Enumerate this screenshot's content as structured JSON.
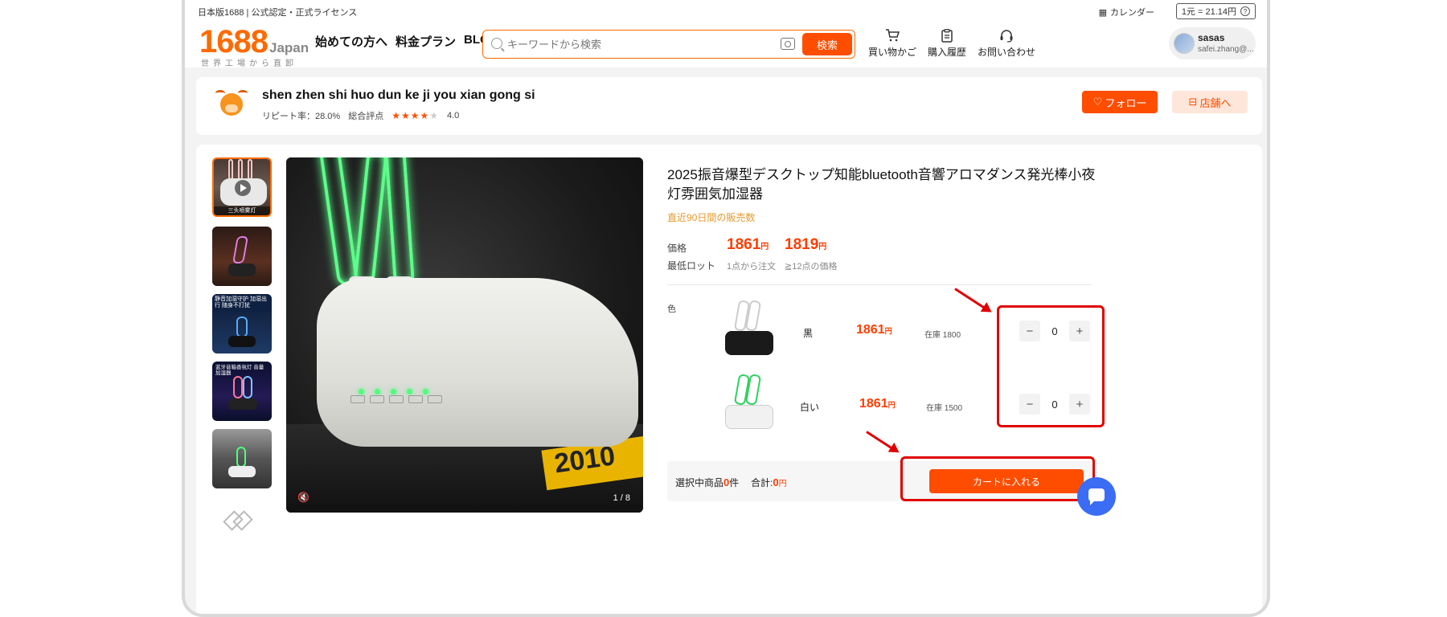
{
  "topbar": {
    "left_text": "日本版1688 | 公式認定・正式ライセンス",
    "calendar_label": "カレンダー",
    "rate_text": "1元 = 21.14円",
    "help_icon": "question-circle-icon",
    "calendar_icon": "calendar-icon"
  },
  "header": {
    "logo_number": "1688",
    "logo_suffix": "Japan",
    "logo_sub": "世界工場から直卸",
    "nav": [
      "始めての方へ",
      "料金プラン",
      "BLOG"
    ],
    "search": {
      "placeholder": "キーワードから検索",
      "button": "検索",
      "icon": "search-icon",
      "camera_icon": "camera-icon"
    },
    "icons": [
      {
        "label": "買い物かご",
        "icon": "cart-icon"
      },
      {
        "label": "購入履歴",
        "icon": "clipboard-icon"
      },
      {
        "label": "お問い合わせ",
        "icon": "headset-icon"
      }
    ],
    "user": {
      "name": "sasas",
      "email": "safei.zhang@..."
    }
  },
  "shop": {
    "name": "shen zhen shi huo dun ke ji you xian gong si",
    "repeat_label": "リピート率：28.0%",
    "rating_label": "総合評点",
    "rating_value": "4.0",
    "rating_stars": 4,
    "follow_label": "フォロー",
    "store_label": "店舗へ"
  },
  "product": {
    "title": "2025振音爆型デスクトップ知能bluetooth音響アロマダンス発光棒小夜灯雰囲気加湿器",
    "sold_label": "直近90日間の販売数",
    "price_label": "価格",
    "moq_label": "最低ロット",
    "tiers": [
      {
        "price": "1861",
        "unit": "円",
        "moq": "1点から注文"
      },
      {
        "price": "1819",
        "unit": "円",
        "moq": "≧12点の価格"
      }
    ],
    "color_label": "色",
    "variants": [
      {
        "name": "黒",
        "price": "1861",
        "unit": "円",
        "stock": "在庫 1800",
        "qty": "0"
      },
      {
        "name": "白い",
        "price": "1861",
        "unit": "円",
        "stock": "在庫 1500",
        "qty": "0"
      }
    ],
    "video_counter": "1 / 8",
    "thumb_caption": "三头喷雾灯",
    "thumb3_text": "静音加湿守护 加湿出行 随身不打扰",
    "thumb4_text": "蓝牙音箱香氛灯 音量加湿器",
    "mute_icon": "mute-icon"
  },
  "cart": {
    "selected_label": "選択中商品",
    "selected_count": "0",
    "selected_unit": "件",
    "total_label": "合計:",
    "total_value": "0",
    "total_unit": "円",
    "add_button": "カートに入れる"
  },
  "colors": {
    "accent": "#ff4d00",
    "annotation": "#e00000",
    "chat": "#3a6cf4"
  }
}
